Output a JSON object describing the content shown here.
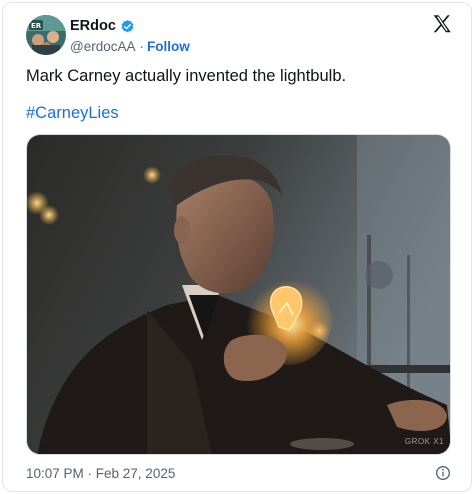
{
  "author": {
    "display_name": "ERdoc",
    "handle": "@erdocAA",
    "separator": "·",
    "follow_label": "Follow"
  },
  "tweet": {
    "text": "Mark Carney actually invented the lightbulb.",
    "hashtag": "#CarneyLies"
  },
  "media": {
    "watermark": "GROK X1",
    "description_icon": "generated-photo"
  },
  "meta": {
    "timestamp": "10:07 PM · Feb 27, 2025"
  },
  "colors": {
    "link": "#1d6fd8",
    "verified": "#1d9bf0",
    "text": "#0f1419",
    "secondary": "#536471"
  },
  "icons": [
    "verified-badge-icon",
    "x-logo-icon",
    "info-icon"
  ]
}
